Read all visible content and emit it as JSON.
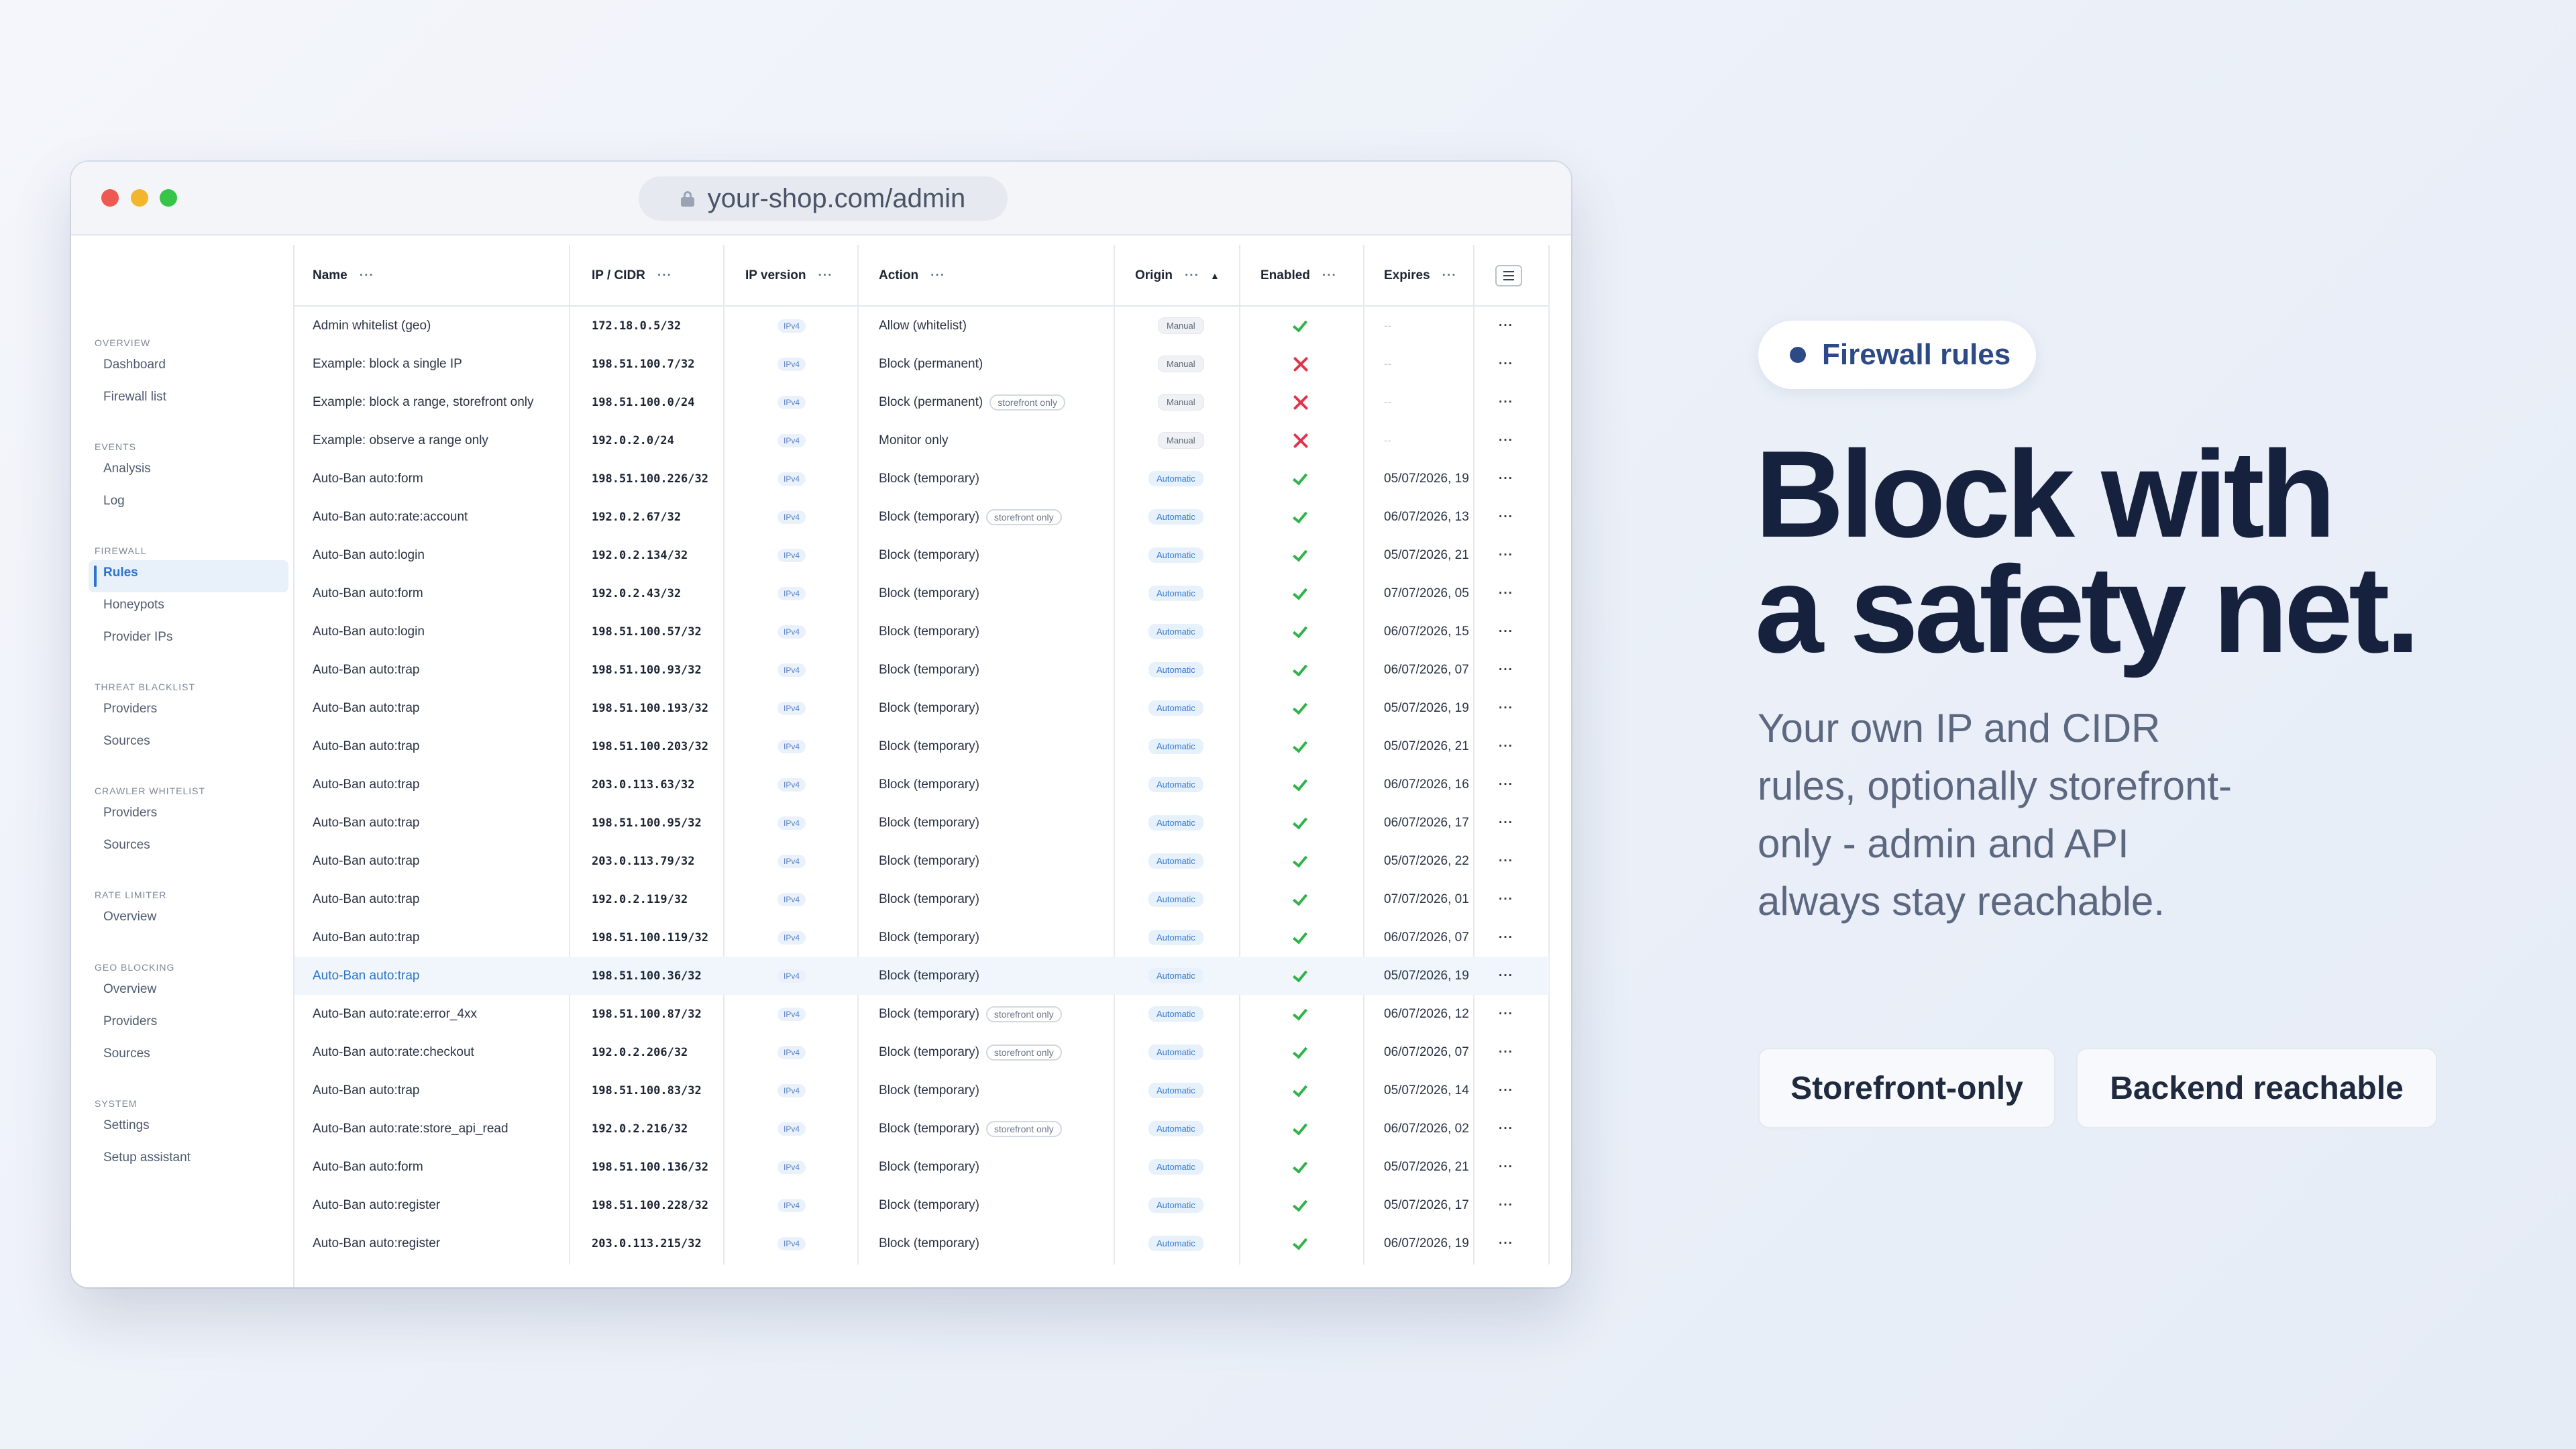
{
  "browser": {
    "url": "your-shop.com/admin"
  },
  "sidebar": {
    "sections": [
      {
        "title": "OVERVIEW",
        "items": [
          "Dashboard",
          "Firewall list"
        ]
      },
      {
        "title": "EVENTS",
        "items": [
          "Analysis",
          "Log"
        ]
      },
      {
        "title": "FIREWALL",
        "items": [
          "Rules",
          "Honeypots",
          "Provider IPs"
        ]
      },
      {
        "title": "THREAT BLACKLIST",
        "items": [
          "Providers",
          "Sources"
        ]
      },
      {
        "title": "CRAWLER WHITELIST",
        "items": [
          "Providers",
          "Sources"
        ]
      },
      {
        "title": "RATE LIMITER",
        "items": [
          "Overview"
        ]
      },
      {
        "title": "GEO BLOCKING",
        "items": [
          "Overview",
          "Providers",
          "Sources"
        ]
      },
      {
        "title": "SYSTEM",
        "items": [
          "Settings",
          "Setup assistant"
        ]
      }
    ],
    "active_item": "Rules"
  },
  "table": {
    "columns": [
      "Name",
      "IP / CIDR",
      "IP version",
      "Action",
      "Origin",
      "Enabled",
      "Expires"
    ],
    "more_glyph": "···",
    "sort_glyph": "▲",
    "row_menu": "···",
    "rows": [
      {
        "name": "Admin whitelist (geo)",
        "ip": "172.18.0.5/32",
        "ipver": "IPv4",
        "action": "Allow (whitelist)",
        "store": "",
        "origin": "Manual",
        "enabled": true,
        "expires": "--"
      },
      {
        "name": "Example: block a single IP",
        "ip": "198.51.100.7/32",
        "ipver": "IPv4",
        "action": "Block (permanent)",
        "store": "",
        "origin": "Manual",
        "enabled": false,
        "expires": "--"
      },
      {
        "name": "Example: block a range, storefront only",
        "ip": "198.51.100.0/24",
        "ipver": "IPv4",
        "action": "Block (permanent)",
        "store": "storefront only",
        "origin": "Manual",
        "enabled": false,
        "expires": "--"
      },
      {
        "name": "Example: observe a range only",
        "ip": "192.0.2.0/24",
        "ipver": "IPv4",
        "action": "Monitor only",
        "store": "",
        "origin": "Manual",
        "enabled": false,
        "expires": "--"
      },
      {
        "name": "Auto-Ban auto:form",
        "ip": "198.51.100.226/32",
        "ipver": "IPv4",
        "action": "Block (temporary)",
        "store": "",
        "origin": "Automatic",
        "enabled": true,
        "expires": "05/07/2026, 19"
      },
      {
        "name": "Auto-Ban auto:rate:account",
        "ip": "192.0.2.67/32",
        "ipver": "IPv4",
        "action": "Block (temporary)",
        "store": "storefront only",
        "origin": "Automatic",
        "enabled": true,
        "expires": "06/07/2026, 13"
      },
      {
        "name": "Auto-Ban auto:login",
        "ip": "192.0.2.134/32",
        "ipver": "IPv4",
        "action": "Block (temporary)",
        "store": "",
        "origin": "Automatic",
        "enabled": true,
        "expires": "05/07/2026, 21"
      },
      {
        "name": "Auto-Ban auto:form",
        "ip": "192.0.2.43/32",
        "ipver": "IPv4",
        "action": "Block (temporary)",
        "store": "",
        "origin": "Automatic",
        "enabled": true,
        "expires": "07/07/2026, 05"
      },
      {
        "name": "Auto-Ban auto:login",
        "ip": "198.51.100.57/32",
        "ipver": "IPv4",
        "action": "Block (temporary)",
        "store": "",
        "origin": "Automatic",
        "enabled": true,
        "expires": "06/07/2026, 15"
      },
      {
        "name": "Auto-Ban auto:trap",
        "ip": "198.51.100.93/32",
        "ipver": "IPv4",
        "action": "Block (temporary)",
        "store": "",
        "origin": "Automatic",
        "enabled": true,
        "expires": "06/07/2026, 07"
      },
      {
        "name": "Auto-Ban auto:trap",
        "ip": "198.51.100.193/32",
        "ipver": "IPv4",
        "action": "Block (temporary)",
        "store": "",
        "origin": "Automatic",
        "enabled": true,
        "expires": "05/07/2026, 19"
      },
      {
        "name": "Auto-Ban auto:trap",
        "ip": "198.51.100.203/32",
        "ipver": "IPv4",
        "action": "Block (temporary)",
        "store": "",
        "origin": "Automatic",
        "enabled": true,
        "expires": "05/07/2026, 21"
      },
      {
        "name": "Auto-Ban auto:trap",
        "ip": "203.0.113.63/32",
        "ipver": "IPv4",
        "action": "Block (temporary)",
        "store": "",
        "origin": "Automatic",
        "enabled": true,
        "expires": "06/07/2026, 16"
      },
      {
        "name": "Auto-Ban auto:trap",
        "ip": "198.51.100.95/32",
        "ipver": "IPv4",
        "action": "Block (temporary)",
        "store": "",
        "origin": "Automatic",
        "enabled": true,
        "expires": "06/07/2026, 17"
      },
      {
        "name": "Auto-Ban auto:trap",
        "ip": "203.0.113.79/32",
        "ipver": "IPv4",
        "action": "Block (temporary)",
        "store": "",
        "origin": "Automatic",
        "enabled": true,
        "expires": "05/07/2026, 22"
      },
      {
        "name": "Auto-Ban auto:trap",
        "ip": "192.0.2.119/32",
        "ipver": "IPv4",
        "action": "Block (temporary)",
        "store": "",
        "origin": "Automatic",
        "enabled": true,
        "expires": "07/07/2026, 01"
      },
      {
        "name": "Auto-Ban auto:trap",
        "ip": "198.51.100.119/32",
        "ipver": "IPv4",
        "action": "Block (temporary)",
        "store": "",
        "origin": "Automatic",
        "enabled": true,
        "expires": "06/07/2026, 07"
      },
      {
        "name": "Auto-Ban auto:trap",
        "ip": "198.51.100.36/32",
        "ipver": "IPv4",
        "action": "Block (temporary)",
        "store": "",
        "origin": "Automatic",
        "enabled": true,
        "expires": "05/07/2026, 19",
        "highlight": true
      },
      {
        "name": "Auto-Ban auto:rate:error_4xx",
        "ip": "198.51.100.87/32",
        "ipver": "IPv4",
        "action": "Block (temporary)",
        "store": "storefront only",
        "origin": "Automatic",
        "enabled": true,
        "expires": "06/07/2026, 12"
      },
      {
        "name": "Auto-Ban auto:rate:checkout",
        "ip": "192.0.2.206/32",
        "ipver": "IPv4",
        "action": "Block (temporary)",
        "store": "storefront only",
        "origin": "Automatic",
        "enabled": true,
        "expires": "06/07/2026, 07"
      },
      {
        "name": "Auto-Ban auto:trap",
        "ip": "198.51.100.83/32",
        "ipver": "IPv4",
        "action": "Block (temporary)",
        "store": "",
        "origin": "Automatic",
        "enabled": true,
        "expires": "05/07/2026, 14"
      },
      {
        "name": "Auto-Ban auto:rate:store_api_read",
        "ip": "192.0.2.216/32",
        "ipver": "IPv4",
        "action": "Block (temporary)",
        "store": "storefront only",
        "origin": "Automatic",
        "enabled": true,
        "expires": "06/07/2026, 02"
      },
      {
        "name": "Auto-Ban auto:form",
        "ip": "198.51.100.136/32",
        "ipver": "IPv4",
        "action": "Block (temporary)",
        "store": "",
        "origin": "Automatic",
        "enabled": true,
        "expires": "05/07/2026, 21"
      },
      {
        "name": "Auto-Ban auto:register",
        "ip": "198.51.100.228/32",
        "ipver": "IPv4",
        "action": "Block (temporary)",
        "store": "",
        "origin": "Automatic",
        "enabled": true,
        "expires": "05/07/2026, 17"
      },
      {
        "name": "Auto-Ban auto:register",
        "ip": "203.0.113.215/32",
        "ipver": "IPv4",
        "action": "Block (temporary)",
        "store": "",
        "origin": "Automatic",
        "enabled": true,
        "expires": "06/07/2026, 19"
      }
    ]
  },
  "promo": {
    "badge": "Firewall rules",
    "headline_line1": "Block with",
    "headline_line2": "a safety net.",
    "subtext": "Your own IP and CIDR rules, optionally storefront-only - admin and API always stay reachable.",
    "button1": "Storefront-only",
    "button2": "Backend reachable"
  },
  "colors": {
    "accent": "#2b74c9",
    "headline": "#16213d",
    "badge": "#2d4a86",
    "check": "#2fb34a",
    "cross": "#e0344a"
  }
}
